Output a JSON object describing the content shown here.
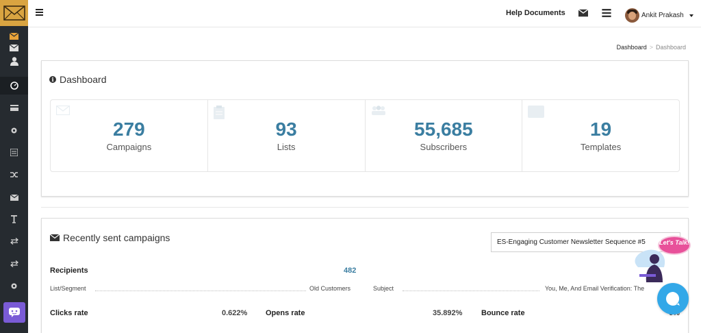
{
  "header": {
    "help_label": "Help Documents",
    "user_name": "Ankit Prakash"
  },
  "breadcrumb": {
    "items": [
      "Dashboard",
      "Dashboard"
    ],
    "separator": ">"
  },
  "dashboard": {
    "title": "Dashboard",
    "stats": [
      {
        "value": "279",
        "label": "Campaigns",
        "icon": "envelope-icon"
      },
      {
        "value": "93",
        "label": "Lists",
        "icon": "clipboard-icon"
      },
      {
        "value": "55,685",
        "label": "Subscribers",
        "icon": "users-icon"
      },
      {
        "value": "19",
        "label": "Templates",
        "icon": "template-icon"
      }
    ]
  },
  "recent": {
    "title": "Recently sent campaigns",
    "selected_campaign": "ES-Engaging Customer Newsletter Sequence #5",
    "recipients_label": "Recipients",
    "recipients_value": "482",
    "list_segment_label": "List/Segment",
    "list_segment_value": "Old Customers",
    "subject_label": "Subject",
    "subject_value": "You, Me, And Email Verification: The",
    "clicks_label": "Clicks rate",
    "clicks_value": "0.622%",
    "opens_label": "Opens rate",
    "opens_value": "35.892%",
    "bounce_label": "Bounce rate",
    "bounce_value": "0%"
  },
  "chat": {
    "bubble_text": "Let's Talk!"
  },
  "colors": {
    "sidebar": "#262b30",
    "logo": "#d9a441",
    "accent": "#3b7ea1",
    "chat_widget": "#33a8e8",
    "lets_talk": "#e8519a",
    "chat_sidebar": "#7a5bd6"
  },
  "sidebar_icons": [
    "envelope-icon",
    "mail-icon",
    "user-icon",
    "dashboard-icon",
    "card-icon",
    "gear-icon",
    "list-icon",
    "shuffle-icon",
    "mail-icon",
    "text-icon",
    "transfer-icon",
    "transfer-icon",
    "settings-icon",
    "chat-icon"
  ]
}
